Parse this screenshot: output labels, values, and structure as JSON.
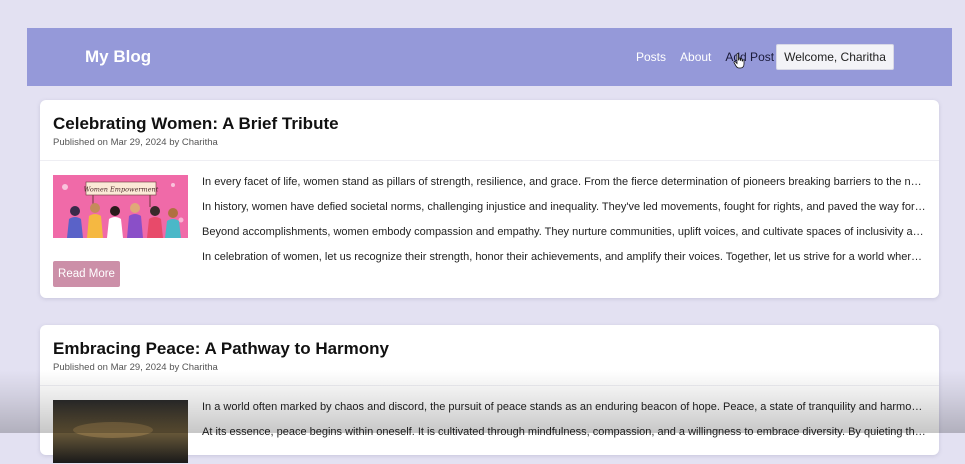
{
  "header": {
    "brand": "My Blog",
    "nav": [
      {
        "label": "Posts"
      },
      {
        "label": "About"
      },
      {
        "label": "Add Post"
      }
    ],
    "welcome": "Welcome, Charitha"
  },
  "posts": [
    {
      "title": "Celebrating Women: A Brief Tribute",
      "meta": "Published on Mar 29, 2024 by Charitha",
      "thumb_caption": "Women Empowerment",
      "paragraphs": [
        "In every facet of life, women stand as pillars of strength, resilience, and grace. From the fierce determination of pioneers breaking barriers to the nurt…",
        "In history, women have defied societal norms, challenging injustice and inequality. They've led movements, fought for rights, and paved the way for pr…",
        "Beyond accomplishments, women embody compassion and empathy. They nurture communities, uplift voices, and cultivate spaces of inclusivity and …",
        "In celebration of women, let us recognize their strength, honor their achievements, and amplify their voices. Together, let us strive for a world where e…"
      ],
      "read_more": "Read More"
    },
    {
      "title": "Embracing Peace: A Pathway to Harmony",
      "meta": "Published on Mar 29, 2024 by Charitha",
      "paragraphs": [
        "In a world often marked by chaos and discord, the pursuit of peace stands as an enduring beacon of hope. Peace, a state of tranquility and harmony, …",
        "At its essence, peace begins within oneself. It is cultivated through mindfulness, compassion, and a willingness to embrace diversity. By quieting the t…"
      ]
    }
  ],
  "colors": {
    "background": "#e3e1f2",
    "navbar": "#9599d9",
    "read_more": "#cc8fa8"
  }
}
